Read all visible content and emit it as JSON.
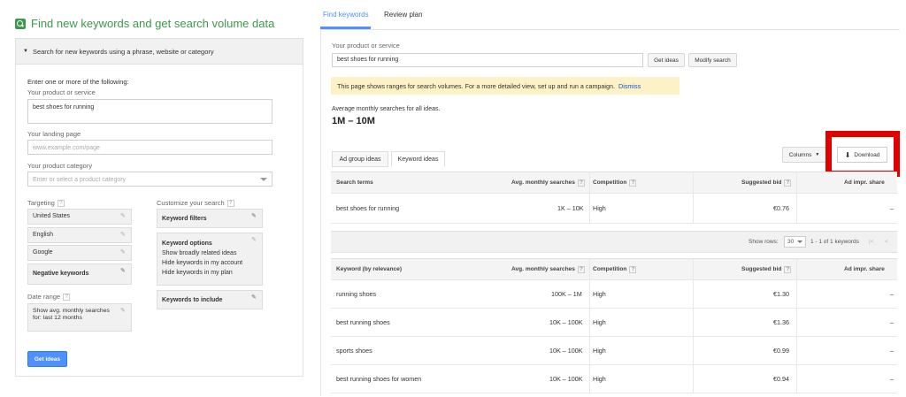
{
  "left": {
    "title": "Find new keywords and get search volume data",
    "collapse_label": "Search for new keywords using a phrase, website or category",
    "enter_label": "Enter one or more of the following:",
    "product_label": "Your product or service",
    "product_value": "best shoes for running",
    "landing_label": "Your landing page",
    "landing_placeholder": "www.example.com/page",
    "category_label": "Your product category",
    "category_placeholder": "Enter or select a product category",
    "targeting_label": "Targeting",
    "targeting": [
      "United States",
      "English",
      "Google"
    ],
    "negative_keywords": "Negative keywords",
    "date_range_label": "Date range",
    "date_range_value_1": "Show avg. monthly searches",
    "date_range_value_2": "for: last 12 months",
    "customize_label": "Customize your search",
    "keyword_filters": "Keyword filters",
    "keyword_options": "Keyword options",
    "keyword_options_lines": [
      "Show broadly related ideas",
      "Hide keywords in my account",
      "Hide keywords in my plan"
    ],
    "keywords_to_include": "Keywords to include",
    "get_ideas": "Get ideas",
    "help_glyph": "?",
    "pencil_glyph": "✎"
  },
  "right": {
    "tabs": [
      "Find keywords",
      "Review plan"
    ],
    "product_label": "Your product or service",
    "product_value": "best shoes for running",
    "get_ideas": "Get ideas",
    "modify_search": "Modify search",
    "notice": "This page shows ranges for search volumes. For a more detailed view, set up and run a campaign.",
    "dismiss": "Dismiss",
    "avg_label": "Average monthly searches for all ideas.",
    "avg_value": "1M – 10M",
    "idea_tabs": [
      "Ad group ideas",
      "Keyword ideas"
    ],
    "columns_btn": "Columns",
    "download_btn": "Download",
    "download_glyph": "⬇",
    "search_terms_head": {
      "term": "Search terms",
      "avg": "Avg. monthly searches",
      "comp": "Competition",
      "bid": "Suggested bid",
      "share": "Ad impr. share"
    },
    "search_terms_rows": [
      {
        "term": "best shoes for running",
        "avg": "1K – 10K",
        "comp": "High",
        "bid": "€0.76",
        "share": "–"
      }
    ],
    "pager": {
      "show_rows": "Show rows:",
      "rows_value": "30",
      "range": "1 - 1 of 1 keywords",
      "first_glyph": "|<",
      "prev_glyph": "<"
    },
    "keyword_head": {
      "term": "Keyword (by relevance)",
      "avg": "Avg. monthly searches",
      "comp": "Competition",
      "bid": "Suggested bid",
      "share": "Ad impr. share"
    },
    "keyword_rows": [
      {
        "term": "running shoes",
        "avg": "100K – 1M",
        "comp": "High",
        "bid": "€1.30",
        "share": "–"
      },
      {
        "term": "best running shoes",
        "avg": "10K – 100K",
        "comp": "High",
        "bid": "€1.36",
        "share": "–"
      },
      {
        "term": "sports shoes",
        "avg": "10K – 100K",
        "comp": "High",
        "bid": "€0.99",
        "share": "–"
      },
      {
        "term": "best running shoes for women",
        "avg": "10K – 100K",
        "comp": "High",
        "bid": "€0.94",
        "share": "–"
      }
    ]
  },
  "colors": {
    "accent_green": "#3a9a4a",
    "accent_blue": "#4d90fe",
    "highlight_red": "#e00000",
    "notice_bg": "#fcf2c5"
  }
}
